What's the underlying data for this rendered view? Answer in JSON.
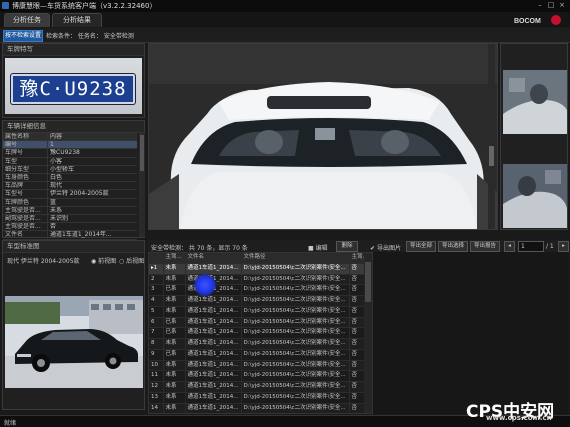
{
  "app": {
    "title": "博康慧眼—车货系统客户端（v3.2.2.32460）",
    "close_glyph": "×",
    "min_glyph": "–",
    "max_glyph": "□"
  },
  "tabs": [
    {
      "label": "分析任务"
    },
    {
      "label": "分析结果"
    }
  ],
  "filter": {
    "button_label": "按不检索设置",
    "text": "检索条件：  任务名：  安全带检测"
  },
  "plate_panel": {
    "title": "车牌特写",
    "plate_text": "豫C·U9238"
  },
  "detail_panel": {
    "title": "车辆详细信息",
    "header": {
      "key": "属性名称",
      "value": "内容"
    },
    "rows": [
      {
        "key": "编号",
        "value": "1"
      },
      {
        "key": "车牌号",
        "value": "豫CU9238"
      },
      {
        "key": "车型",
        "value": "小客"
      },
      {
        "key": "细分车型",
        "value": "小型轿车"
      },
      {
        "key": "车身颜色",
        "value": "白色"
      },
      {
        "key": "车品牌",
        "value": "现代"
      },
      {
        "key": "车型号",
        "value": "伊兰特 2004-2005款"
      },
      {
        "key": "车牌颜色",
        "value": "蓝"
      },
      {
        "key": "主驾驶是否...",
        "value": "未系"
      },
      {
        "key": "副驾驶是否...",
        "value": "未识别"
      },
      {
        "key": "主驾驶是否...",
        "value": "否"
      },
      {
        "key": "文件名",
        "value": "通道1车道1_2014年..."
      }
    ]
  },
  "model_panel": {
    "title": "车型标准图",
    "model": "现代 伊兰特 2004-2005款",
    "front_label": "前视图",
    "rear_label": "后视图"
  },
  "results": {
    "count_text": "安全带检测：  共 70 条，显示 70 条",
    "edit_label": "编辑",
    "delete_label": "删除",
    "export_img_label": "导出图片",
    "export_btn1": "导出全部",
    "export_btn2": "导出选择",
    "export_btn3": "导出报告",
    "page_value": "1",
    "page_total": "/ 1",
    "columns": [
      "",
      "主驾...",
      "文件名",
      "文件路径",
      "主驾..."
    ],
    "rows": [
      {
        "n": "1",
        "a": "未系",
        "f": "通道1车道1_2014...",
        "p": "D:\\yjd-20150504\\c二次识别案件\\安全...",
        "b": "否"
      },
      {
        "n": "2",
        "a": "未系",
        "f": "通道1车道1_2014...",
        "p": "D:\\yjd-20150504\\c二次识别案件\\安全...",
        "b": "否"
      },
      {
        "n": "3",
        "a": "已系",
        "f": "通道1车道1_2014...",
        "p": "D:\\yjd-20150504\\c二次识别案件\\安全...",
        "b": "否"
      },
      {
        "n": "4",
        "a": "未系",
        "f": "通道1车道1_2014...",
        "p": "D:\\yjd-20150504\\c二次识别案件\\安全...",
        "b": "否"
      },
      {
        "n": "5",
        "a": "未系",
        "f": "通道1车道1_2014...",
        "p": "D:\\yjd-20150504\\c二次识别案件\\安全...",
        "b": "否"
      },
      {
        "n": "6",
        "a": "已系",
        "f": "通道1车道1_2014...",
        "p": "D:\\yjd-20150504\\c二次识别案件\\安全...",
        "b": "否"
      },
      {
        "n": "7",
        "a": "已系",
        "f": "通道1车道1_2014...",
        "p": "D:\\yjd-20150504\\c二次识别案件\\安全...",
        "b": "否"
      },
      {
        "n": "8",
        "a": "未系",
        "f": "通道1车道1_2014...",
        "p": "D:\\yjd-20150504\\c二次识别案件\\安全...",
        "b": "否"
      },
      {
        "n": "9",
        "a": "已系",
        "f": "通道1车道1_2014...",
        "p": "D:\\yjd-20150504\\c二次识别案件\\安全...",
        "b": "否"
      },
      {
        "n": "10",
        "a": "未系",
        "f": "通道1车道1_2014...",
        "p": "D:\\yjd-20150504\\c二次识别案件\\安全...",
        "b": "否"
      },
      {
        "n": "11",
        "a": "未系",
        "f": "通道1车道1_2014...",
        "p": "D:\\yjd-20150504\\c二次识别案件\\安全...",
        "b": "否"
      },
      {
        "n": "12",
        "a": "未系",
        "f": "通道1车道1_2014...",
        "p": "D:\\yjd-20150504\\c二次识别案件\\安全...",
        "b": "否"
      },
      {
        "n": "13",
        "a": "未系",
        "f": "通道1车道1_2014...",
        "p": "D:\\yjd-20150504\\c二次识别案件\\安全...",
        "b": "否"
      },
      {
        "n": "14",
        "a": "未系",
        "f": "通道1车道1_2014...",
        "p": "D:\\yjd-20150504\\c二次识别案件\\安全...",
        "b": "否"
      }
    ]
  },
  "status": {
    "text": "就绪"
  },
  "brand": {
    "logo": "BOCOM"
  },
  "watermark": {
    "text": "CPS中安网",
    "url": "www.cps.com.cn"
  },
  "colors": {
    "accent": "#1f5a9e",
    "plate_blue": "#1c3f8f",
    "background": "#1a1a1a"
  }
}
